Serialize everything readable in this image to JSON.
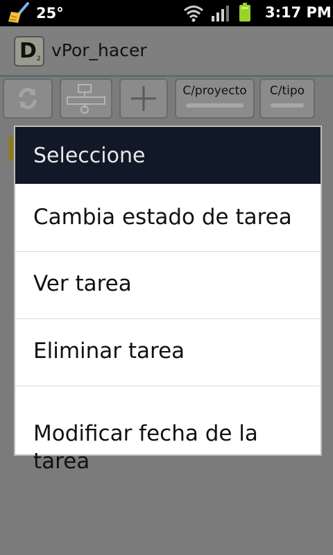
{
  "status_bar": {
    "temperature": "25°",
    "time": "3:17 PM",
    "icons": [
      "broom-icon",
      "wifi-icon",
      "signal-icon",
      "battery-icon"
    ]
  },
  "action_bar": {
    "app_icon_letter": "D",
    "app_icon_subscript": "2",
    "title": "vPor_hacer"
  },
  "toolbar": {
    "buttons": [
      {
        "icon": "refresh-icon"
      },
      {
        "icon": "flowchart-icon"
      },
      {
        "icon": "plus-icon"
      },
      {
        "label": "C/proyecto"
      },
      {
        "label": "C/tipo"
      }
    ]
  },
  "dialog": {
    "title": "Seleccione",
    "items": [
      {
        "label": "Cambia estado de tarea"
      },
      {
        "label": "Ver tarea"
      },
      {
        "label": "Eliminar tarea"
      },
      {
        "label": "Modificar fecha de la\ntarea"
      }
    ]
  },
  "colors": {
    "dim_background": "#7b7b7b",
    "dialog_header": "#111827",
    "battery": "#9ad12b"
  }
}
